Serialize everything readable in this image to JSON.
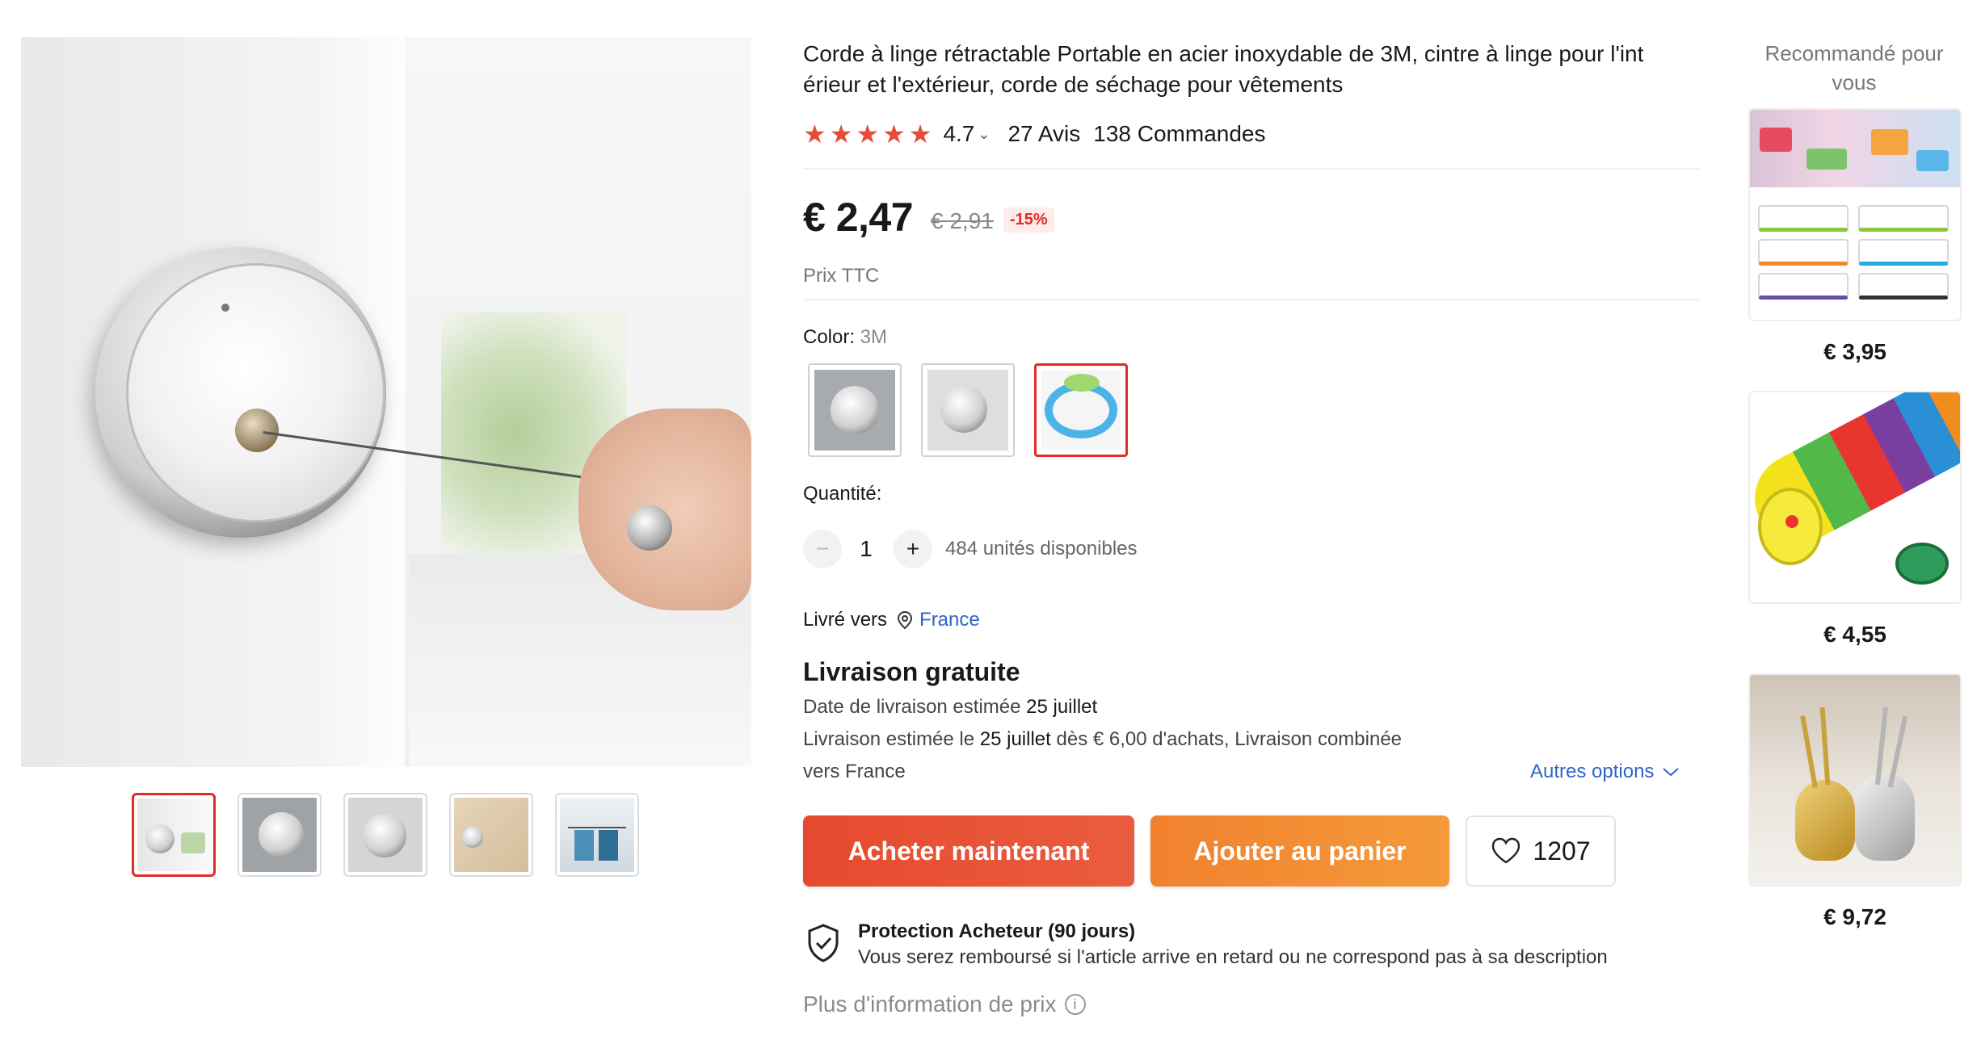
{
  "product": {
    "title_line1": "Corde à linge rétractable Portable en acier inoxydable de 3M, cintre à linge pour l'int",
    "title_line2": "érieur et l'extérieur, corde de séchage pour vêtements",
    "rating": "4.7",
    "reviews": "27 Avis",
    "orders": "138 Commandes",
    "stars_filled": 5
  },
  "price": {
    "current": "€ 2,47",
    "original": "€ 2,91",
    "discount": "-15%",
    "note": "Prix TTC"
  },
  "color": {
    "label": "Color: ",
    "selected": "3M",
    "options": [
      "chrome-reel-grey",
      "chrome-reel-light",
      "blue-cord"
    ],
    "selected_index": 2
  },
  "quantity": {
    "label": "Quantité:",
    "minus": "−",
    "plus": "+",
    "value": "1",
    "available": "484 unités disponibles"
  },
  "shipping": {
    "to_label": "Livré vers",
    "country": "France",
    "free": "Livraison gratuite",
    "date_line_prefix": "Date de livraison estimée ",
    "date_line_date": "25 juillet",
    "est_line_prefix": "Livraison estimée le ",
    "est_line_date": "25 juillet",
    "est_line_suffix": " dès € 6,00 d'achats, Livraison combinée",
    "est_line2": "vers France",
    "other_options": "Autres options"
  },
  "actions": {
    "buy_now": "Acheter maintenant",
    "add_to_cart": "Ajouter au panier",
    "wishlist_count": "1207"
  },
  "protection": {
    "title": "Protection Acheteur (90 jours)",
    "description": "Vous serez remboursé si l'article arrive en retard ou ne correspond pas à sa description"
  },
  "more_price_info": "Plus d'information de prix",
  "gallery": {
    "selected_index": 0,
    "thumbnail_count": 5
  },
  "recommended": {
    "title_line1": "Recommandé pour",
    "title_line2": "vous",
    "items": [
      {
        "price": "€ 3,95",
        "icon": "fridge-basket-image"
      },
      {
        "price": "€ 4,55",
        "icon": "cat-tunnel-image"
      },
      {
        "price": "€ 9,72",
        "icon": "swan-spoon-set-image"
      }
    ]
  },
  "colors": {
    "accent_red": "#e02b27",
    "star": "#e44d3a",
    "buy_button": "#e64a2e",
    "cart_button": "#f2812e",
    "link_blue": "#2e64c8"
  }
}
